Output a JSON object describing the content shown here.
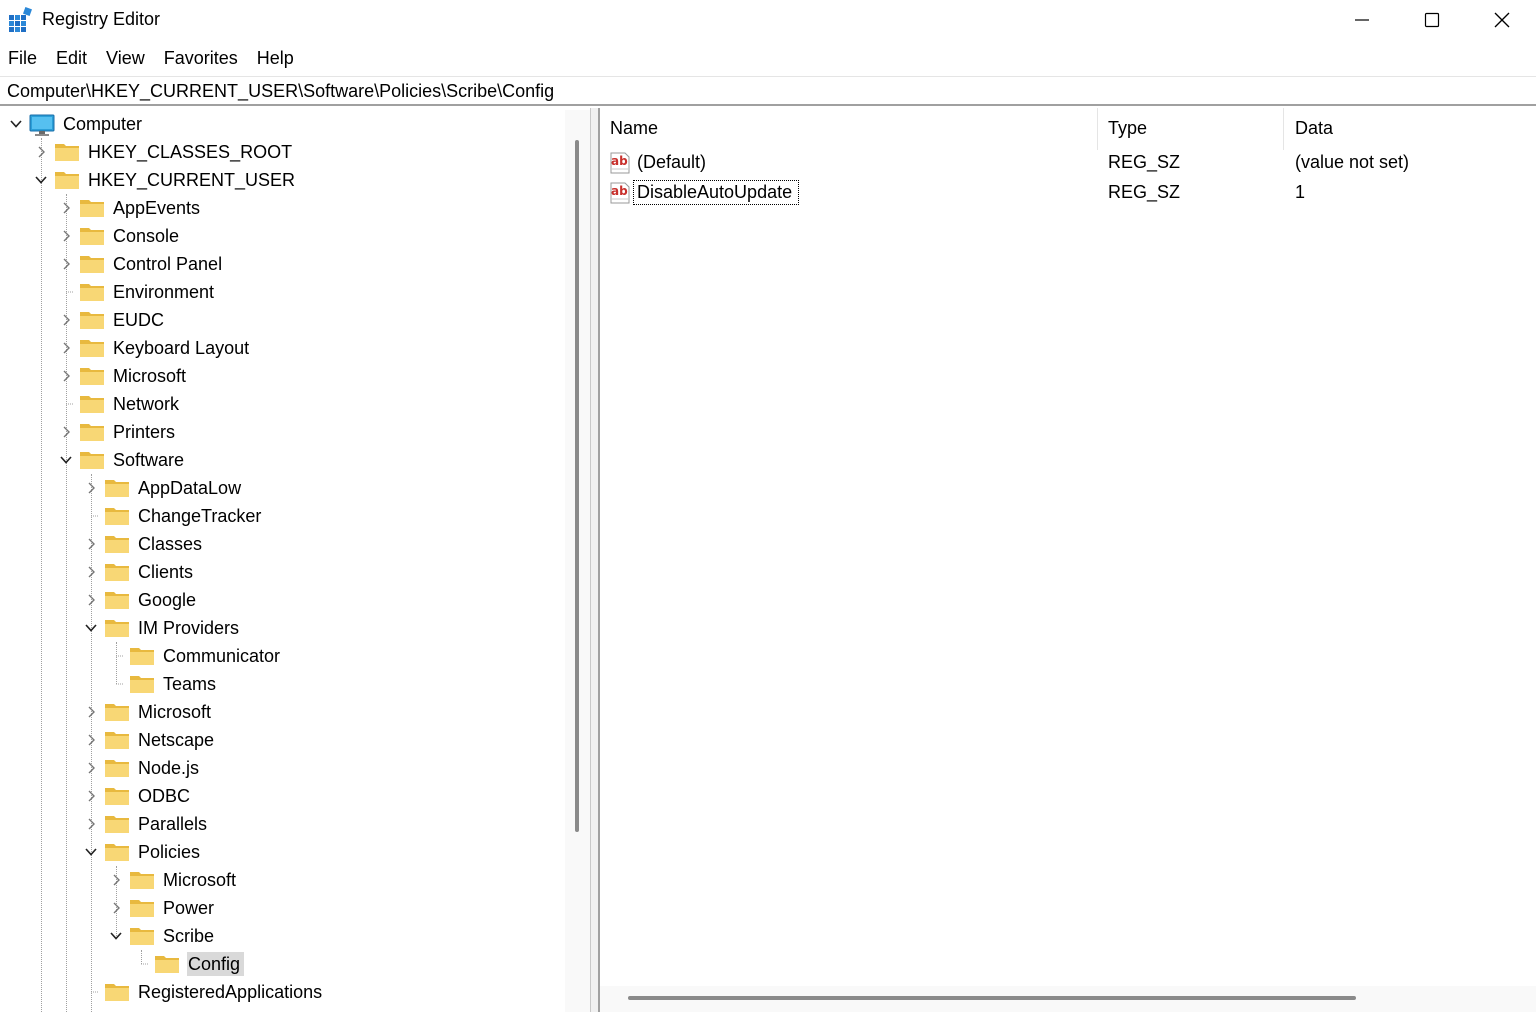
{
  "window": {
    "title": "Registry Editor",
    "icon": "registry-editor-icon"
  },
  "menu": [
    "File",
    "Edit",
    "View",
    "Favorites",
    "Help"
  ],
  "address": "Computer\\HKEY_CURRENT_USER\\Software\\Policies\\Scribe\\Config",
  "tree": [
    {
      "label": "Computer",
      "depth": 0,
      "state": "expanded",
      "icon": "computer-icon"
    },
    {
      "label": "HKEY_CLASSES_ROOT",
      "depth": 1,
      "state": "collapsed"
    },
    {
      "label": "HKEY_CURRENT_USER",
      "depth": 1,
      "state": "expanded"
    },
    {
      "label": "AppEvents",
      "depth": 2,
      "state": "collapsed"
    },
    {
      "label": "Console",
      "depth": 2,
      "state": "collapsed"
    },
    {
      "label": "Control Panel",
      "depth": 2,
      "state": "collapsed"
    },
    {
      "label": "Environment",
      "depth": 2,
      "state": "leaf"
    },
    {
      "label": "EUDC",
      "depth": 2,
      "state": "collapsed"
    },
    {
      "label": "Keyboard Layout",
      "depth": 2,
      "state": "collapsed"
    },
    {
      "label": "Microsoft",
      "depth": 2,
      "state": "collapsed"
    },
    {
      "label": "Network",
      "depth": 2,
      "state": "leaf"
    },
    {
      "label": "Printers",
      "depth": 2,
      "state": "collapsed"
    },
    {
      "label": "Software",
      "depth": 2,
      "state": "expanded"
    },
    {
      "label": "AppDataLow",
      "depth": 3,
      "state": "collapsed"
    },
    {
      "label": "ChangeTracker",
      "depth": 3,
      "state": "leaf"
    },
    {
      "label": "Classes",
      "depth": 3,
      "state": "collapsed"
    },
    {
      "label": "Clients",
      "depth": 3,
      "state": "collapsed"
    },
    {
      "label": "Google",
      "depth": 3,
      "state": "collapsed"
    },
    {
      "label": "IM Providers",
      "depth": 3,
      "state": "expanded"
    },
    {
      "label": "Communicator",
      "depth": 4,
      "state": "leaf"
    },
    {
      "label": "Teams",
      "depth": 4,
      "state": "leaf"
    },
    {
      "label": "Microsoft",
      "depth": 3,
      "state": "collapsed"
    },
    {
      "label": "Netscape",
      "depth": 3,
      "state": "collapsed"
    },
    {
      "label": "Node.js",
      "depth": 3,
      "state": "collapsed"
    },
    {
      "label": "ODBC",
      "depth": 3,
      "state": "collapsed"
    },
    {
      "label": "Parallels",
      "depth": 3,
      "state": "collapsed"
    },
    {
      "label": "Policies",
      "depth": 3,
      "state": "expanded"
    },
    {
      "label": "Microsoft",
      "depth": 4,
      "state": "collapsed"
    },
    {
      "label": "Power",
      "depth": 4,
      "state": "collapsed"
    },
    {
      "label": "Scribe",
      "depth": 4,
      "state": "expanded"
    },
    {
      "label": "Config",
      "depth": 5,
      "state": "leaf",
      "selected": true
    },
    {
      "label": "RegisteredApplications",
      "depth": 3,
      "state": "leaf"
    }
  ],
  "columns": {
    "name": "Name",
    "type": "Type",
    "data": "Data"
  },
  "values": [
    {
      "name": "(Default)",
      "type": "REG_SZ",
      "data": "(value not set)",
      "icon": "string-value-icon"
    },
    {
      "name": "DisableAutoUpdate",
      "type": "REG_SZ",
      "data": "1",
      "icon": "string-value-icon",
      "focused": true
    }
  ],
  "colors": {
    "folder": "#f8d775",
    "folder_dark": "#e8b93f",
    "selection": "#d9d9d9",
    "value_icon_red": "#c8302c"
  }
}
